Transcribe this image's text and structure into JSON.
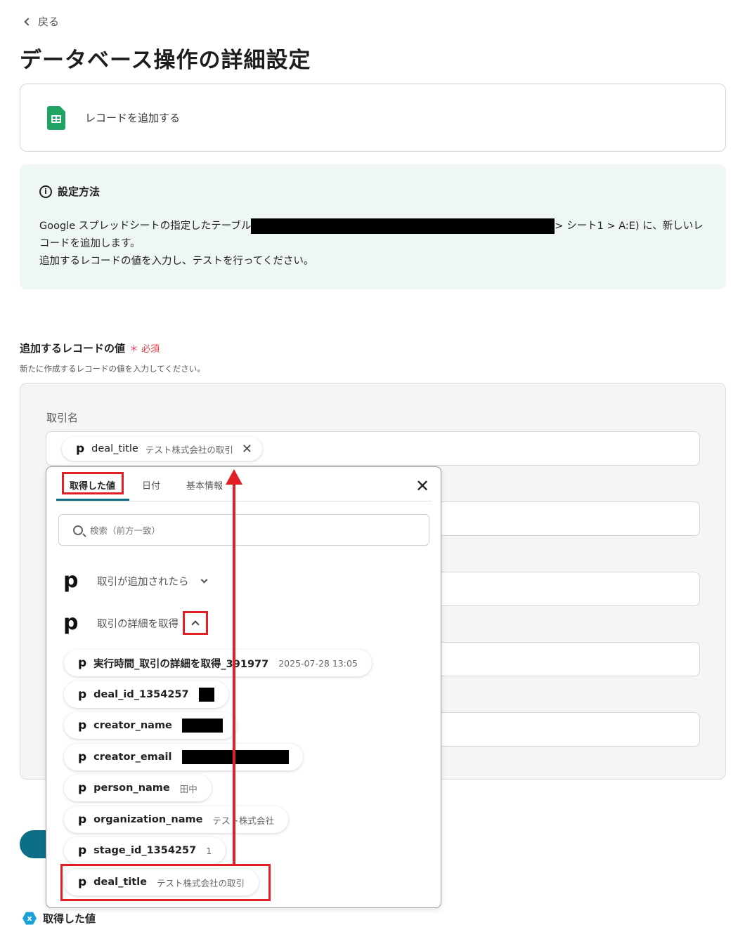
{
  "back": {
    "label": "戻る"
  },
  "page": {
    "title": "データベース操作の詳細設定"
  },
  "action": {
    "icon": "google-sheets-icon",
    "label": "レコードを追加する"
  },
  "info": {
    "heading": "設定方法",
    "line1_prefix": "Google スプレッドシートの指定したテーブル",
    "line1_suffix": "> シート1 > A:E) に、新しいレ",
    "line2": "コードを追加します。",
    "line3": "追加するレコードの値を入力し、テストを行ってください。"
  },
  "field": {
    "label": "追加するレコードの値",
    "required": "＊ 必須",
    "description": "新たに作成するレコードの値を入力してください。",
    "sub_label": "取引名",
    "chip_name": "deal_title",
    "chip_value": "テスト株式会社の取引"
  },
  "dropdown": {
    "tabs": [
      "取得した値",
      "日付",
      "基本情報"
    ],
    "active_tab": "取得した値",
    "search_placeholder": "検索（前方一致）",
    "groups": [
      {
        "label": "取引が追加されたら",
        "expanded": false
      },
      {
        "label": "取引の詳細を取得",
        "expanded": true
      }
    ],
    "options": [
      {
        "name": "実行時間_取引の詳細を取得_391977",
        "value": "2025-07-28 13:05"
      },
      {
        "name": "deal_id_1354257",
        "value": "",
        "redacted": true
      },
      {
        "name": "creator_name",
        "value": "",
        "redacted": true
      },
      {
        "name": "creator_email",
        "value": "",
        "redacted": true
      },
      {
        "name": "person_name",
        "value": "田中"
      },
      {
        "name": "organization_name",
        "value": "テスト株式会社"
      },
      {
        "name": "stage_id_1354257",
        "value": "1"
      },
      {
        "name": "deal_title",
        "value": "テスト株式会社の取引"
      }
    ]
  },
  "footer": {
    "label": "取得した値"
  },
  "colors": {
    "accent": "#0c6f86",
    "annotation": "#e11f26",
    "required": "#e53945",
    "info_bg": "#eef7f6"
  }
}
